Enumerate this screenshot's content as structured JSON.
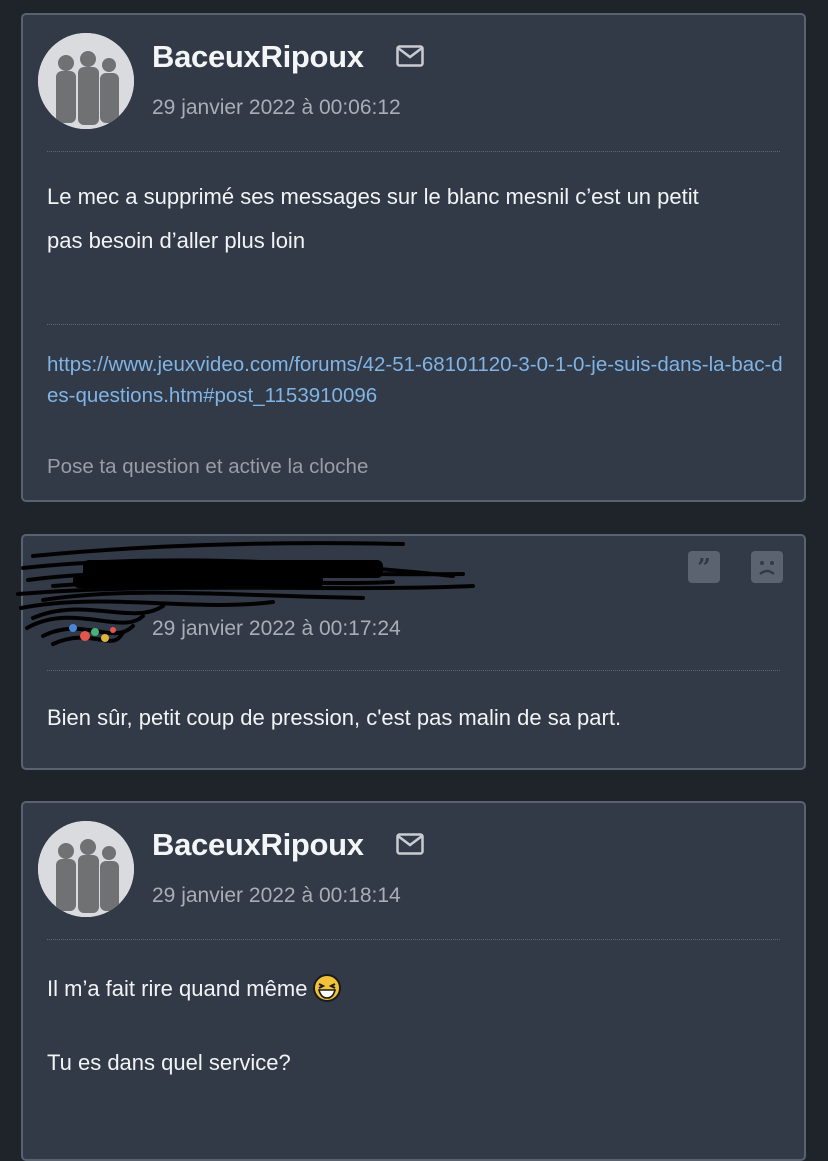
{
  "posts": [
    {
      "author": "BaceuxRipoux",
      "date": "29 janvier 2022 à 00:06:12",
      "body": [
        "Le mec a supprimé ses messages sur le blanc mesnil c’est un petit",
        "pas besoin d’aller plus loin"
      ],
      "signature_link": "https://www.jeuxvideo.com/forums/42-51-68101120-3-0-1-0-je-suis-dans-la-bac-des-questions.htm#post_1153910096",
      "signature_text": "Pose ta question et active la cloche"
    },
    {
      "author": "",
      "date": "29 janvier 2022 à 00:17:24",
      "body": "Bien sûr, petit coup de pression, c'est pas malin de sa part."
    },
    {
      "author": "BaceuxRipoux",
      "date": "29 janvier 2022 à 00:18:14",
      "body_line1": "Il m’a fait rire quand même",
      "body_line2": "Tu es dans quel service?"
    }
  ],
  "icons": {
    "mail": "mail-icon",
    "quote": "quote-icon",
    "report": "sad-face-icon",
    "emoji": "laughing-emoji-icon"
  },
  "colors": {
    "page_bg": "#1f232a",
    "post_bg": "#323a47",
    "border": "#5a6270",
    "link": "#7fb4e6",
    "muted": "#a9aeb6"
  }
}
